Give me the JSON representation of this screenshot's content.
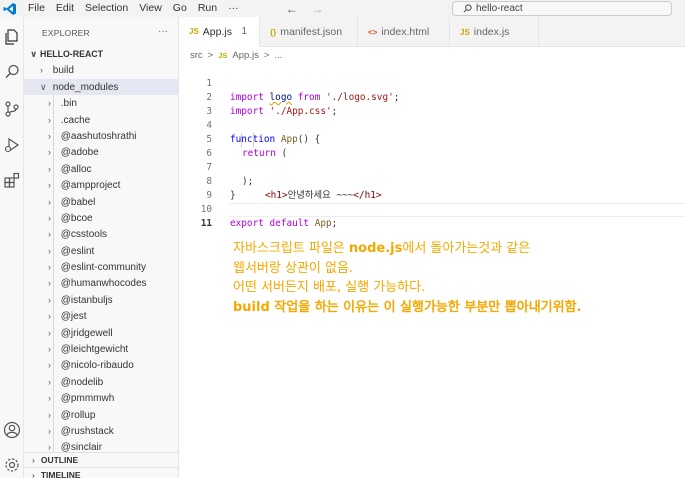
{
  "titlebar": {
    "menu": [
      "File",
      "Edit",
      "Selection",
      "View",
      "Go",
      "Run",
      "···"
    ],
    "search_text": "hello-react",
    "colors": {
      "logo": "#0078d4"
    }
  },
  "sidebar": {
    "header": "EXPLORER",
    "more": "···",
    "root": "HELLO-REACT",
    "items": [
      {
        "label": "build",
        "level": 1,
        "expanded": false
      },
      {
        "label": "node_modules",
        "level": 1,
        "expanded": true,
        "selected": true
      },
      {
        "label": ".bin",
        "level": 2
      },
      {
        "label": ".cache",
        "level": 2
      },
      {
        "label": "@aashutoshrathi",
        "level": 2
      },
      {
        "label": "@adobe",
        "level": 2
      },
      {
        "label": "@alloc",
        "level": 2
      },
      {
        "label": "@ampproject",
        "level": 2
      },
      {
        "label": "@babel",
        "level": 2
      },
      {
        "label": "@bcoe",
        "level": 2
      },
      {
        "label": "@csstools",
        "level": 2
      },
      {
        "label": "@eslint",
        "level": 2
      },
      {
        "label": "@eslint-community",
        "level": 2
      },
      {
        "label": "@humanwhocodes",
        "level": 2
      },
      {
        "label": "@istanbuljs",
        "level": 2
      },
      {
        "label": "@jest",
        "level": 2
      },
      {
        "label": "@jridgewell",
        "level": 2
      },
      {
        "label": "@leichtgewicht",
        "level": 2
      },
      {
        "label": "@nicolo-ribaudo",
        "level": 2
      },
      {
        "label": "@nodelib",
        "level": 2
      },
      {
        "label": "@pmmmwh",
        "level": 2
      },
      {
        "label": "@rollup",
        "level": 2
      },
      {
        "label": "@rushstack",
        "level": 2
      },
      {
        "label": "@sinclair",
        "level": 2
      }
    ],
    "outline": "OUTLINE",
    "timeline": "TIMELINE"
  },
  "tabs": [
    {
      "label": "App.js",
      "icon": "JS",
      "badge": "1",
      "active": true
    },
    {
      "label": "manifest.json",
      "icon": "{}",
      "active": false
    },
    {
      "label": "index.html",
      "icon": "<>",
      "active": false
    },
    {
      "label": "index.js",
      "icon": "JS",
      "active": false
    }
  ],
  "breadcrumb": {
    "folder": "src",
    "sep": ">",
    "icon": "JS",
    "file": "App.js",
    "more": "..."
  },
  "code": {
    "line_numbers": [
      "1",
      "2",
      "3",
      "4",
      "5",
      "6",
      "7",
      "8",
      "9",
      "10",
      "11"
    ],
    "l1": {
      "import": "import",
      "logo": "logo",
      "from": "from",
      "path": "'./logo.svg'",
      "semi": ";"
    },
    "l2": {
      "import": "import",
      "path": "'./App.css'",
      "semi": ";"
    },
    "l4": {
      "function": "function",
      "name": "App",
      "rest": "() {"
    },
    "l5": {
      "return": "return",
      "rest": " ("
    },
    "l6": {
      "open": "<h1>",
      "text": "안녕하세요 ~~~",
      "close": "</h1>"
    },
    "l7": {
      "text": ");"
    },
    "l8": {
      "text": "}"
    },
    "l10": {
      "export": "export",
      "default": "default",
      "name": "App",
      "semi": ";"
    }
  },
  "note": {
    "line1_pre": "자바스크립트 파일은 ",
    "line1_bold": "node.js",
    "line1_post": "에서 돌아가는것과 같은",
    "line2": "웹서버랑 상관이 없음.",
    "line3": "어떤 서버든지 배포, 실행 가능하다.",
    "line4_bold": "build",
    "line4_post": " 작업을 하는 이유는 이 실행가능한 부분만 뽑아내기위함.",
    "color": "#f5a800"
  }
}
